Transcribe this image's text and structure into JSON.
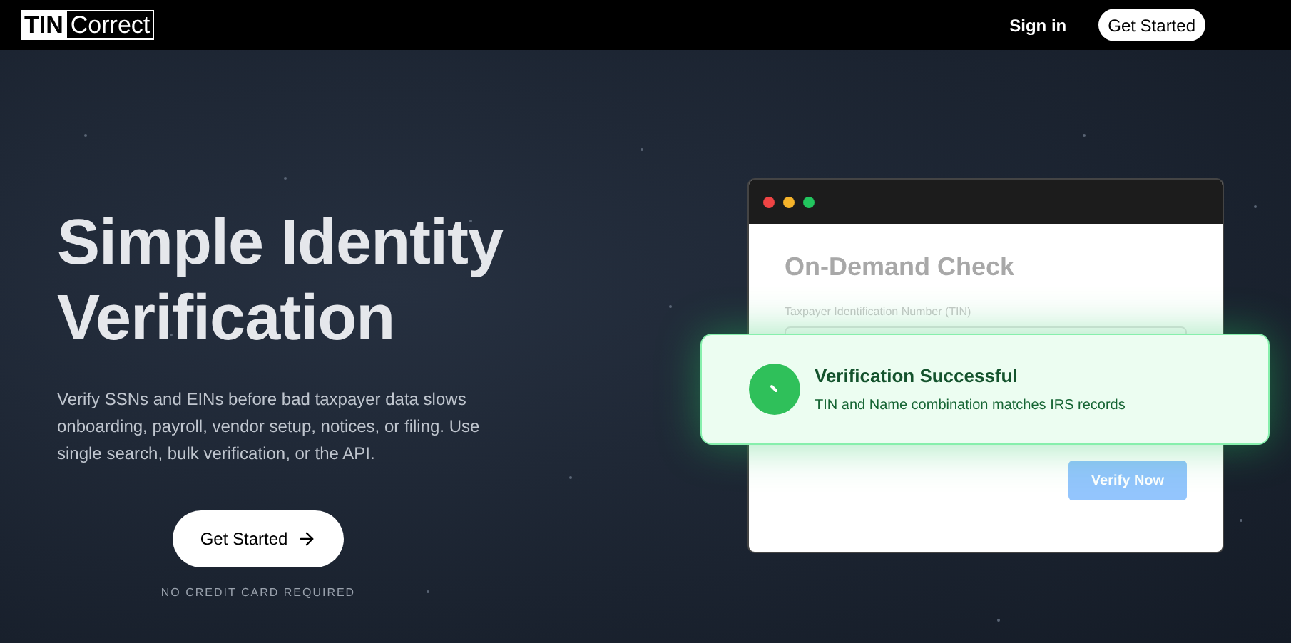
{
  "header": {
    "logo": {
      "part_1": "TIN",
      "part_2": "Correct"
    },
    "sign_in": "Sign in",
    "cta": "Get Started"
  },
  "hero": {
    "title": "Simple Identity Verification",
    "description": "Verify SSNs and EINs before bad taxpayer data slows onboarding, payroll, vendor setup, notices, or filing. Use single search, bulk verification, or the API.",
    "cta": "Get Started",
    "note": "NO CREDIT CARD REQUIRED"
  },
  "demo_window": {
    "title": "On-Demand Check",
    "field_label": "Taxpayer Identification Number (TIN)",
    "button": "Verify Now"
  },
  "toast": {
    "title": "Verification Successful",
    "message": "TIN and Name combination matches IRS records"
  }
}
